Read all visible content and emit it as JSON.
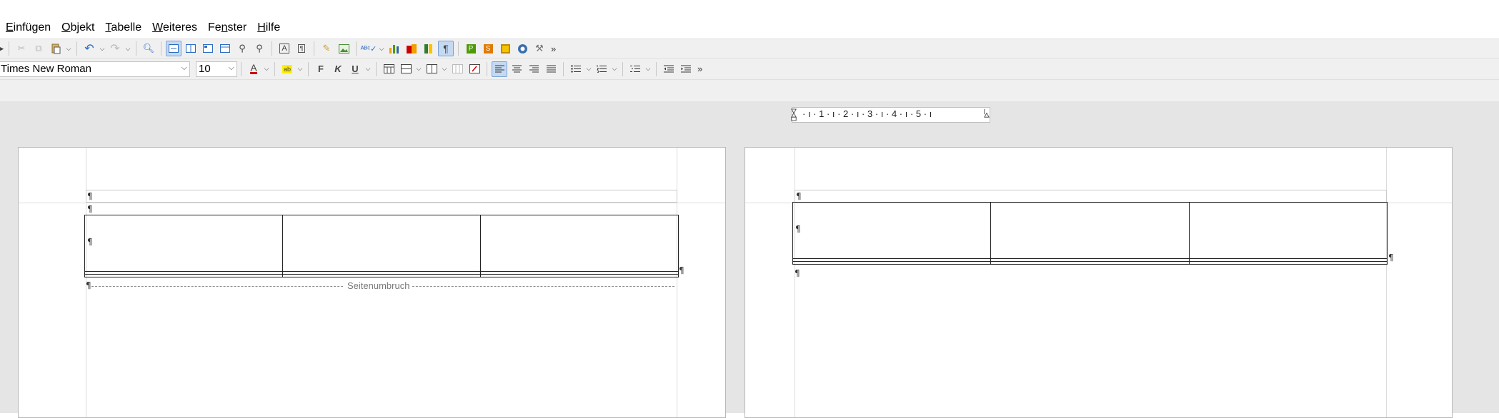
{
  "menu": {
    "items": [
      {
        "label": "Einfügen",
        "underline": "E",
        "rest": "infügen"
      },
      {
        "label": "Objekt",
        "underline": "O",
        "rest": "bjekt"
      },
      {
        "label": "Tabelle",
        "underline": "T",
        "rest": "abelle"
      },
      {
        "label": "Weiteres",
        "underline": "W",
        "rest": "eiteres"
      },
      {
        "label": "Fenster",
        "underline": "",
        "rest": ""
      },
      {
        "label": "Hilfe",
        "underline": "H",
        "rest": "ilfe"
      }
    ],
    "fenster_pre": "Fe",
    "fenster_u": "n",
    "fenster_post": "ster"
  },
  "formatting": {
    "font_name": "Times New Roman",
    "font_size": "10",
    "bold": "F",
    "italic": "K",
    "underline": "U"
  },
  "toolbar": {
    "more": "»",
    "pilcrow": "¶",
    "text_box": "A",
    "letter_p": "P",
    "letter_s": "S"
  },
  "ruler": {
    "numbers": "· ı · 1 · ı · 2 · ı · 3 · ı · 4 · ı · 5 · ı"
  },
  "document": {
    "pilcrow": "¶",
    "page_break_label": "Seitenumbruch",
    "page1_table_rows": 3,
    "page1_table_cols": 3,
    "page2_table_rows": 3,
    "page2_table_cols": 3
  },
  "colors": {
    "font_color": "#cc0000",
    "highlight": "#ffee00",
    "active_btn": "#c5d9f1",
    "workspace": "#e5e5e5"
  }
}
